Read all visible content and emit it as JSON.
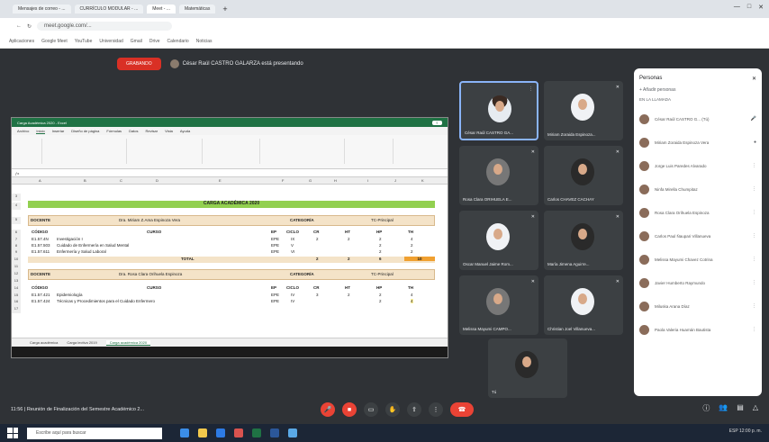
{
  "browser": {
    "tabs": [
      "Mensajes de correo - ...",
      "CURRÍCULO MODULAR - ...",
      "Meet - ...",
      "Matemáticas"
    ],
    "address": "meet.google.com/...",
    "bookmarks": [
      "Aplicaciones",
      "Google Meet",
      "YouTube",
      "Universidad",
      "Gmail",
      "Drive",
      "Calendario",
      "Noticias"
    ]
  },
  "meet": {
    "recording_label": "GRABANDO",
    "presenter_text": "César Raúl CASTRO GALARZA está presentando",
    "meeting_title": "11:56 | Reunión de Finalización del Semestre Académico 2...",
    "panel": {
      "title": "Personas",
      "add_people": "Añadir personas",
      "section": "EN LA LLAMADA",
      "participants": [
        "César Raúl CASTRO G... (Tú)",
        "Miriam Zoraida Espinoza Vera",
        "Jorge Luis Paredes Alvarado",
        "Ninfa Mirella Chumpitaz",
        "Rosa Clara Orihuela Espinoza",
        "Carlos Paul Ñaupari Villanueva",
        "Melissa Mayumi Chavez Cotrina",
        "Javier Humberto Raymundo",
        "Miluska Arana Díaz",
        "Paola Valeria Huamán Bautista"
      ]
    },
    "tiles": [
      {
        "name": "César Raúl CASTRO GA..."
      },
      {
        "name": "Miriam Zoraida Espinoza..."
      },
      {
        "name": "Rosa Clara ORIHUELA E..."
      },
      {
        "name": "Carlos CHAVEZ CACHAY"
      },
      {
        "name": "Oscar Manuel Jaime Rom..."
      },
      {
        "name": "María Jimena Aguirre..."
      },
      {
        "name": "Melissa Mayumi CAMPO..."
      },
      {
        "name": "Christian Joel Villanueva..."
      },
      {
        "name": "Tú"
      }
    ]
  },
  "excel": {
    "window_title": "Carga Académica 2020 - Excel",
    "ribbon_tabs": [
      "Archivo",
      "Inicio",
      "Insertar",
      "Diseño de página",
      "Fórmulas",
      "Datos",
      "Revisar",
      "Vista",
      "Ayuda"
    ],
    "columns": [
      "A",
      "B",
      "C",
      "D",
      "E",
      "F",
      "G",
      "H",
      "I",
      "J",
      "K"
    ],
    "banner": "CARGA ACADÉMICA 2020",
    "block1": {
      "docente_label": "DOCENTE",
      "docente": "Dra. Miriam Z.Ama Espinoza Vera",
      "categoria_label": "CATEGORÍA",
      "categoria": "TC-Principal",
      "headers": [
        "CÓDIGO",
        "CURSO",
        "EP",
        "CICLO",
        "CR",
        "HT",
        "HP",
        "TH"
      ],
      "rows": [
        [
          "E1.57.4N",
          "Investigación I",
          "EPE",
          "IX",
          "2",
          "2",
          "2",
          "4"
        ],
        [
          "E1.57.503",
          "Cuidado de Enfermería en Salud Mental",
          "EPE",
          "V",
          "",
          "",
          "2",
          "2"
        ],
        [
          "E1.57.611",
          "Enfermería y Salud Laboral",
          "EPE",
          "VI",
          "",
          "",
          "2",
          "2"
        ]
      ],
      "total_label": "TOTAL",
      "totals": [
        "2",
        "2",
        "6",
        "10"
      ]
    },
    "block2": {
      "docente_label": "DOCENTE",
      "docente": "Dra. Rosa Clara Orihuela Espinoza",
      "categoria_label": "CATEGORÍA",
      "categoria": "TC-Principal",
      "headers": [
        "CÓDIGO",
        "CURSO",
        "EP",
        "CICLO",
        "CR",
        "HT",
        "HP",
        "TH"
      ],
      "rows": [
        [
          "E1.57.421",
          "Epidemiología",
          "EPE",
          "IV",
          "3",
          "2",
          "2",
          "4"
        ],
        [
          "E1.57.424",
          "Técnicas y Procedimientos para el Cuidado Enfermero",
          "EPE",
          "IV",
          "",
          "",
          "2",
          "4"
        ]
      ]
    },
    "sheet_tabs": [
      "Carga académica",
      "Carga lectiva 2019",
      "Carga académica 2020"
    ],
    "row_numbers": [
      "3",
      "4",
      "5",
      "6",
      "7",
      "8",
      "9",
      "10",
      "11",
      "12",
      "13",
      "14",
      "15",
      "16",
      "17"
    ]
  },
  "taskbar": {
    "search_placeholder": "Escribe aquí para buscar",
    "tray": "ESP 12:00 p. m."
  },
  "colors": {
    "meet_bg": "#2f3236",
    "excel_green": "#1f7244",
    "banner_green": "#92d050",
    "red": "#ea4335"
  }
}
